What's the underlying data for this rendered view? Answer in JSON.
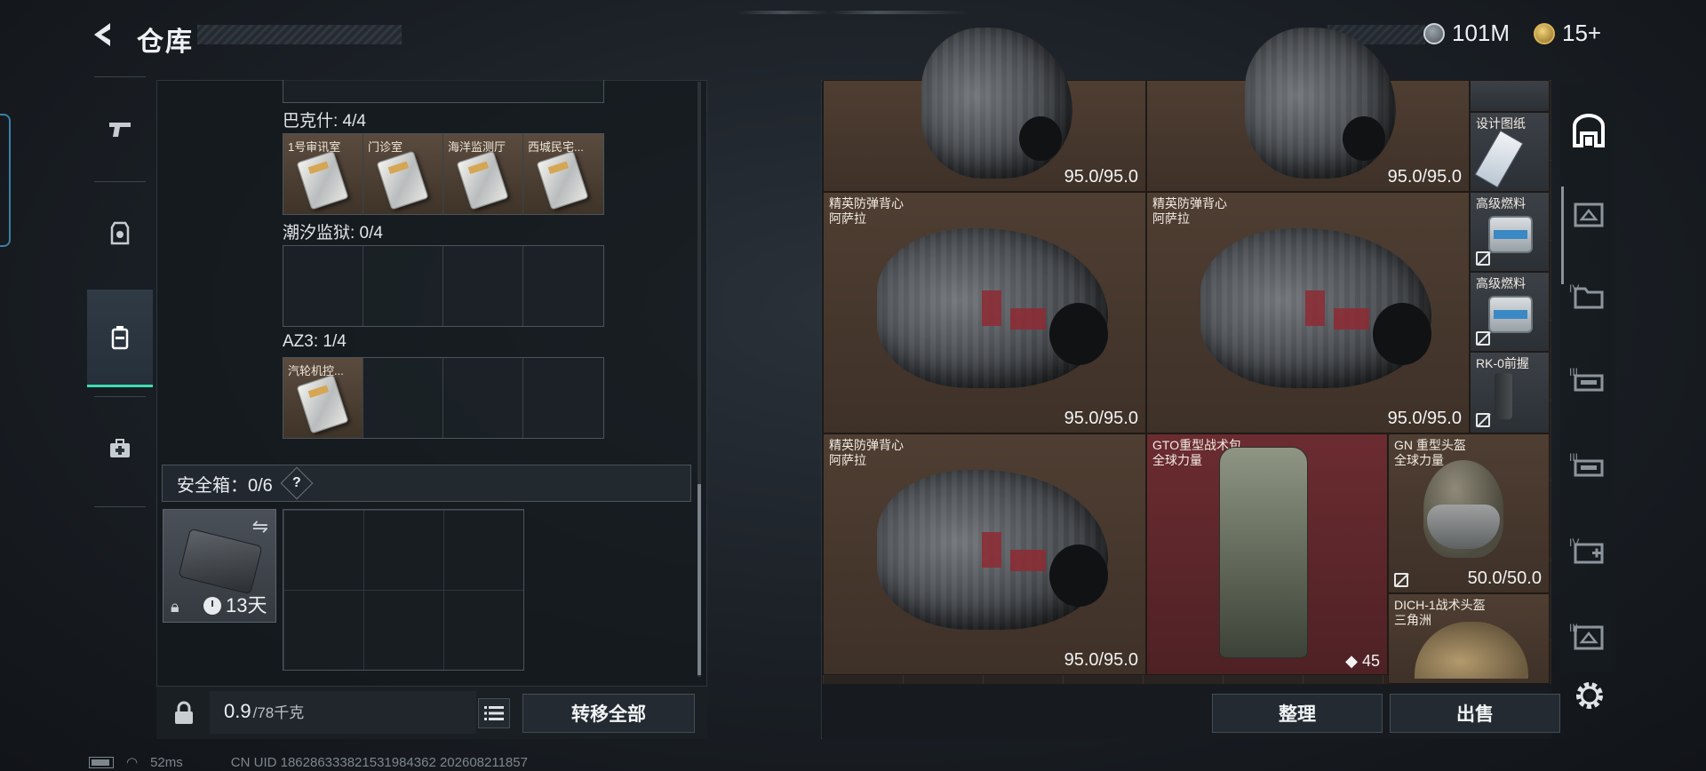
{
  "header": {
    "title": "仓库",
    "currency_silver": "101M",
    "currency_gold": "15+"
  },
  "left_rail": {
    "items": [
      {
        "icon": "pistol-icon"
      },
      {
        "icon": "armor-icon"
      },
      {
        "icon": "backpack-icon",
        "active": true
      },
      {
        "icon": "medkit-icon"
      }
    ]
  },
  "keycard_sections": [
    {
      "label": "巴克什: 4/4",
      "slots": [
        "1号审讯室",
        "门诊室",
        "海洋监测厅",
        "西城民宅..."
      ]
    },
    {
      "label": "潮汐监狱: 0/4",
      "slots": [
        "",
        "",
        "",
        ""
      ]
    },
    {
      "label": "AZ3: 1/4",
      "slots": [
        "汽轮机控...",
        "",
        "",
        ""
      ]
    }
  ],
  "safe_box": {
    "title": "安全箱：0/6",
    "help": "?",
    "case_time": "13天"
  },
  "left_bottom": {
    "weight_current": "0.9",
    "weight_max": "/78千克",
    "transfer_all": "转移全部"
  },
  "stash_items": [
    {
      "name": "",
      "sub": "",
      "durability": "95.0/95.0"
    },
    {
      "name": "",
      "sub": "",
      "durability": "95.0/95.0"
    },
    {
      "name": "设计图纸",
      "sub": ""
    },
    {
      "name": "精英防弹背心",
      "sub": "阿萨拉",
      "durability": "95.0/95.0"
    },
    {
      "name": "精英防弹背心",
      "sub": "阿萨拉",
      "durability": "95.0/95.0"
    },
    {
      "name": "高级燃料",
      "sub": ""
    },
    {
      "name": "高级燃料",
      "sub": ""
    },
    {
      "name": "RK-0前握",
      "sub": ""
    },
    {
      "name": "精英防弹背心",
      "sub": "阿萨拉",
      "durability": "95.0/95.0"
    },
    {
      "name": "GTO重型战术包",
      "sub": "全球力量",
      "count": "45"
    },
    {
      "name": "GN 重型头盔",
      "sub": "全球力量",
      "durability": "50.0/50.0"
    },
    {
      "name": "DICH-1战术头盔",
      "sub": "三角洲"
    }
  ],
  "right_bottom": {
    "organize": "整理",
    "sell": "出售"
  },
  "right_rail": {
    "roman": [
      "IV",
      "III",
      "III",
      "IV",
      "III"
    ]
  },
  "status": {
    "ping": "52ms",
    "uid": "CN UID 1862863338215319843​62 202608211857"
  },
  "colors": {
    "accent_green": "#3fdcb0",
    "stash_brown": "#4f3e32",
    "stash_red": "#6b2c30"
  }
}
